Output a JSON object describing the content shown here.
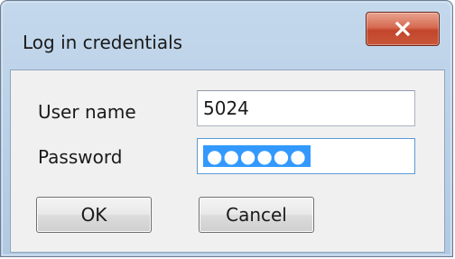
{
  "window": {
    "title": "Log in credentials"
  },
  "titlebar": {
    "close_icon": "close-x-icon"
  },
  "form": {
    "username_label": "User name",
    "username_value": "5024",
    "password_label": "Password",
    "password_masked": "●●●●●●"
  },
  "buttons": {
    "ok_label": "OK",
    "cancel_label": "Cancel"
  },
  "colors": {
    "titlebar": "#bcd2e8",
    "close_button": "#c9573b",
    "selection": "#3399ff",
    "client_bg": "#f0f0f0"
  }
}
